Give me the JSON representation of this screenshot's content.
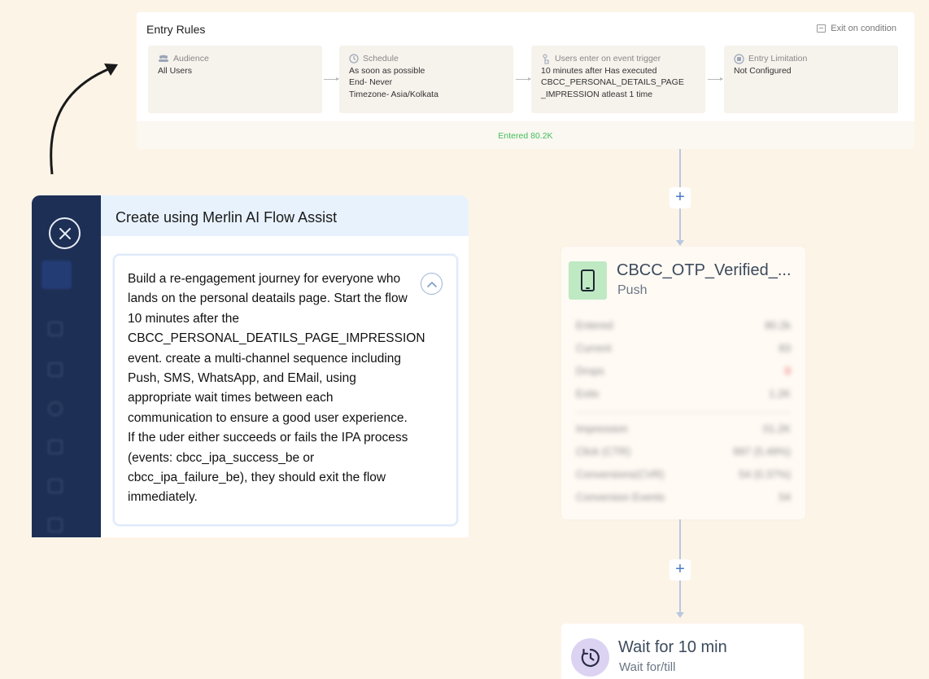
{
  "entry_rules": {
    "title": "Entry Rules",
    "exit_label": "Exit on condition",
    "cards": [
      {
        "head": "Audience",
        "lines": [
          "All Users"
        ],
        "icon": "users-icon"
      },
      {
        "head": "Schedule",
        "lines": [
          "As soon as possible",
          "End- Never",
          "Timezone- Asia/Kolkata"
        ],
        "icon": "clock-icon"
      },
      {
        "head": "Users enter on event trigger",
        "lines": [
          "10 minutes after Has executed",
          "CBCC_PERSONAL_DETAILS_PAGE",
          "_IMPRESSION atleast 1 time"
        ],
        "icon": "touch-icon"
      },
      {
        "head": "Entry Limitation",
        "lines": [
          "Not Configured"
        ],
        "icon": "stop-icon"
      }
    ],
    "entered": "Entered 80.2K"
  },
  "push_node": {
    "title": "CBCC_OTP_Verified_...",
    "subtitle": "Push",
    "stats": [
      {
        "label": "Entered",
        "value": "80.2k"
      },
      {
        "label": "Current",
        "value": "83"
      },
      {
        "label": "Drops",
        "value": "0"
      },
      {
        "label": "Exits",
        "value": "1.2K"
      }
    ],
    "metrics": [
      {
        "label": "Impression",
        "value": "01.2K"
      },
      {
        "label": "Click (CTR)",
        "value": "997 (5.49%)"
      },
      {
        "label": "Conversions(CVR)",
        "value": "54 (0.37%)"
      },
      {
        "label": "Conversion Events",
        "value": "54"
      }
    ],
    "colors": {
      "icon_bg": "#bfe9c3"
    }
  },
  "wait_node": {
    "title": "Wait for 10 min",
    "subtitle": "Wait for/till"
  },
  "merlin": {
    "title": "Create using Merlin AI Flow Assist",
    "prompt": "Build a re-engagement journey for everyone who lands on the personal deatails page. Start the flow 10 minutes after the CBCC_PERSONAL_DEATILS_PAGE_IMPRESSION event. create a multi-channel sequence including Push, SMS, WhatsApp, and EMail, using appropriate wait times between each communication to ensure a good user experience. If the uder either succeeds or fails the IPA process (events: cbcc_ipa_success_be or cbcc_ipa_failure_be), they should exit the flow immediately.",
    "close_icon": "close-icon",
    "collapse_icon": "chevron-up-icon"
  },
  "colors": {
    "background": "#fdf4e8",
    "entered_green": "#3fbf5a",
    "connector": "#b8c8e0",
    "plus_blue": "#4a78c8",
    "sidebar": "#1d2f55"
  }
}
